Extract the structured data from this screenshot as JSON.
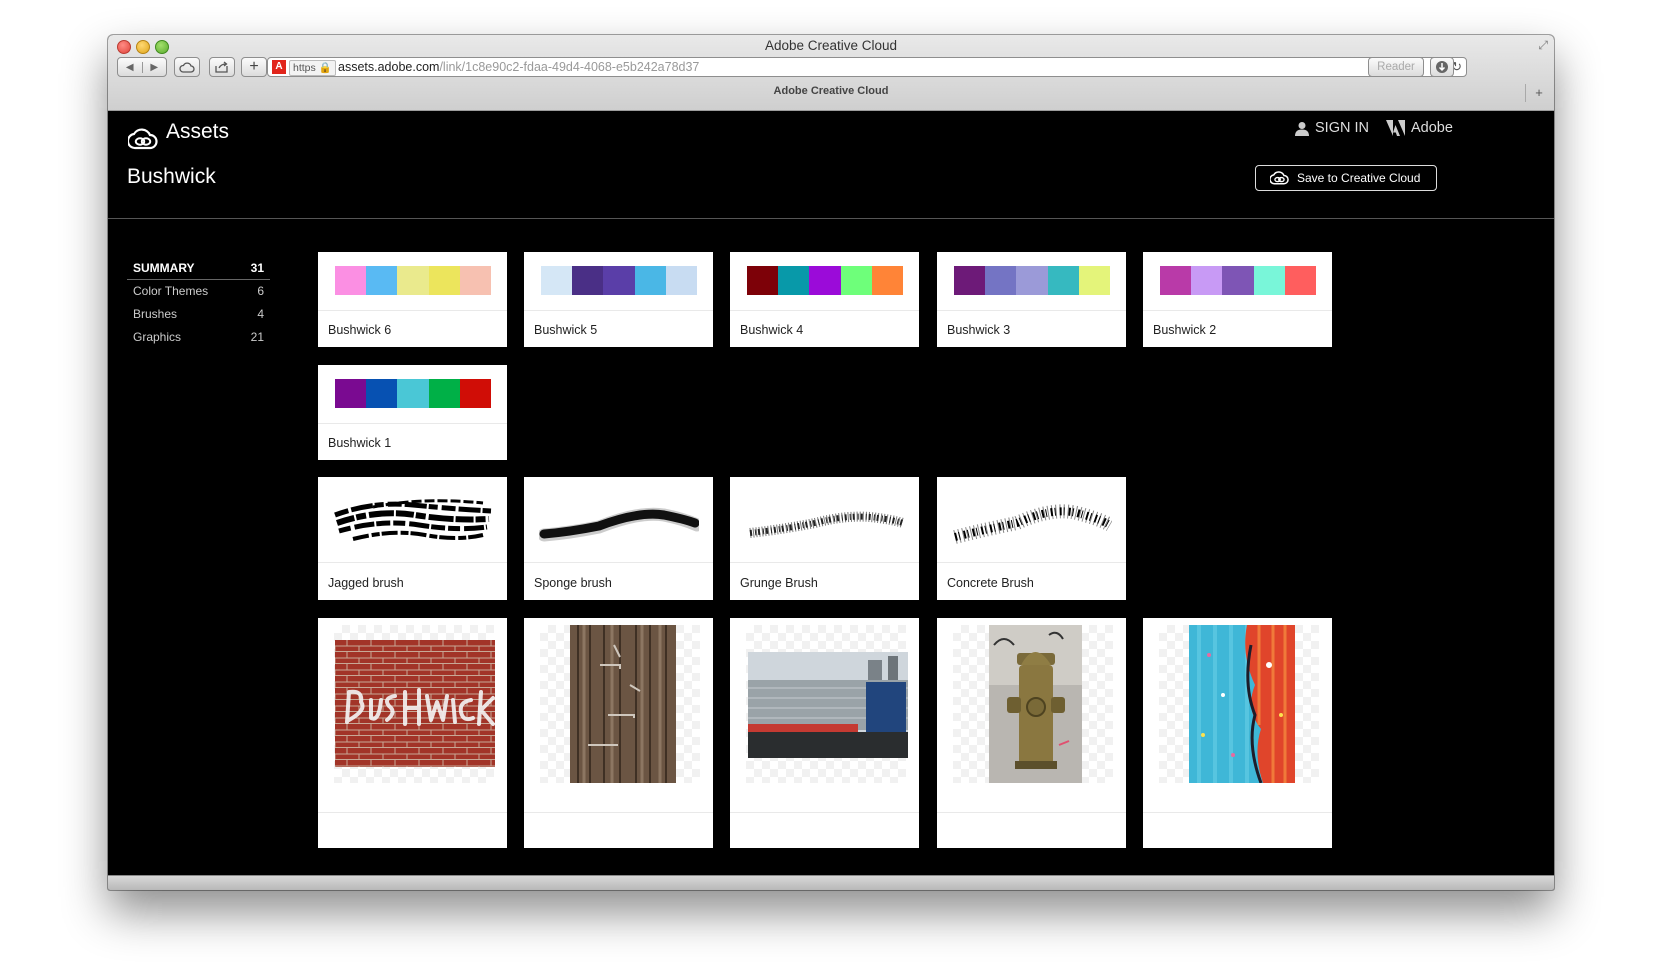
{
  "window": {
    "title": "Adobe Creative Cloud",
    "tab_title": "Adobe Creative Cloud",
    "url_scheme": "https",
    "url_host": "assets.adobe.com",
    "url_path": "/link/1c8e90c2-fdaa-49d4-4068-e5b242a78d37",
    "reader_label": "Reader"
  },
  "header": {
    "app_name": "Assets",
    "page_title": "Bushwick",
    "sign_in": "SIGN IN",
    "adobe": "Adobe",
    "save_button": "Save to Creative Cloud"
  },
  "sidebar": {
    "items": [
      {
        "label": "SUMMARY",
        "count": "31"
      },
      {
        "label": "Color Themes",
        "count": "6"
      },
      {
        "label": "Brushes",
        "count": "4"
      },
      {
        "label": "Graphics",
        "count": "21"
      }
    ]
  },
  "color_themes": [
    {
      "name": "Bushwick 6",
      "colors": [
        "#fb8fe3",
        "#59baf3",
        "#eaea8d",
        "#ece55c",
        "#f7c1b1"
      ]
    },
    {
      "name": "Bushwick 5",
      "colors": [
        "#d5e7f6",
        "#4a2f86",
        "#5a3ea8",
        "#4ab7e6",
        "#c8dcf2"
      ]
    },
    {
      "name": "Bushwick 4",
      "colors": [
        "#7d0108",
        "#0899a9",
        "#9b0bd9",
        "#6eff7a",
        "#ff8437"
      ]
    },
    {
      "name": "Bushwick 3",
      "colors": [
        "#6d1a78",
        "#7474c4",
        "#9b9ad8",
        "#36b9c0",
        "#e4f47a"
      ]
    },
    {
      "name": "Bushwick 2",
      "colors": [
        "#b93aa8",
        "#c89af5",
        "#7e55b5",
        "#79f6d9",
        "#ff5e5e"
      ]
    },
    {
      "name": "Bushwick 1",
      "colors": [
        "#7a0a91",
        "#0751b2",
        "#4ac7d6",
        "#00b047",
        "#d00d06"
      ]
    }
  ],
  "brushes": [
    {
      "name": "Jagged brush"
    },
    {
      "name": "Sponge brush"
    },
    {
      "name": "Grunge Brush"
    },
    {
      "name": "Concrete Brush"
    }
  ],
  "graphics_visible": 5
}
